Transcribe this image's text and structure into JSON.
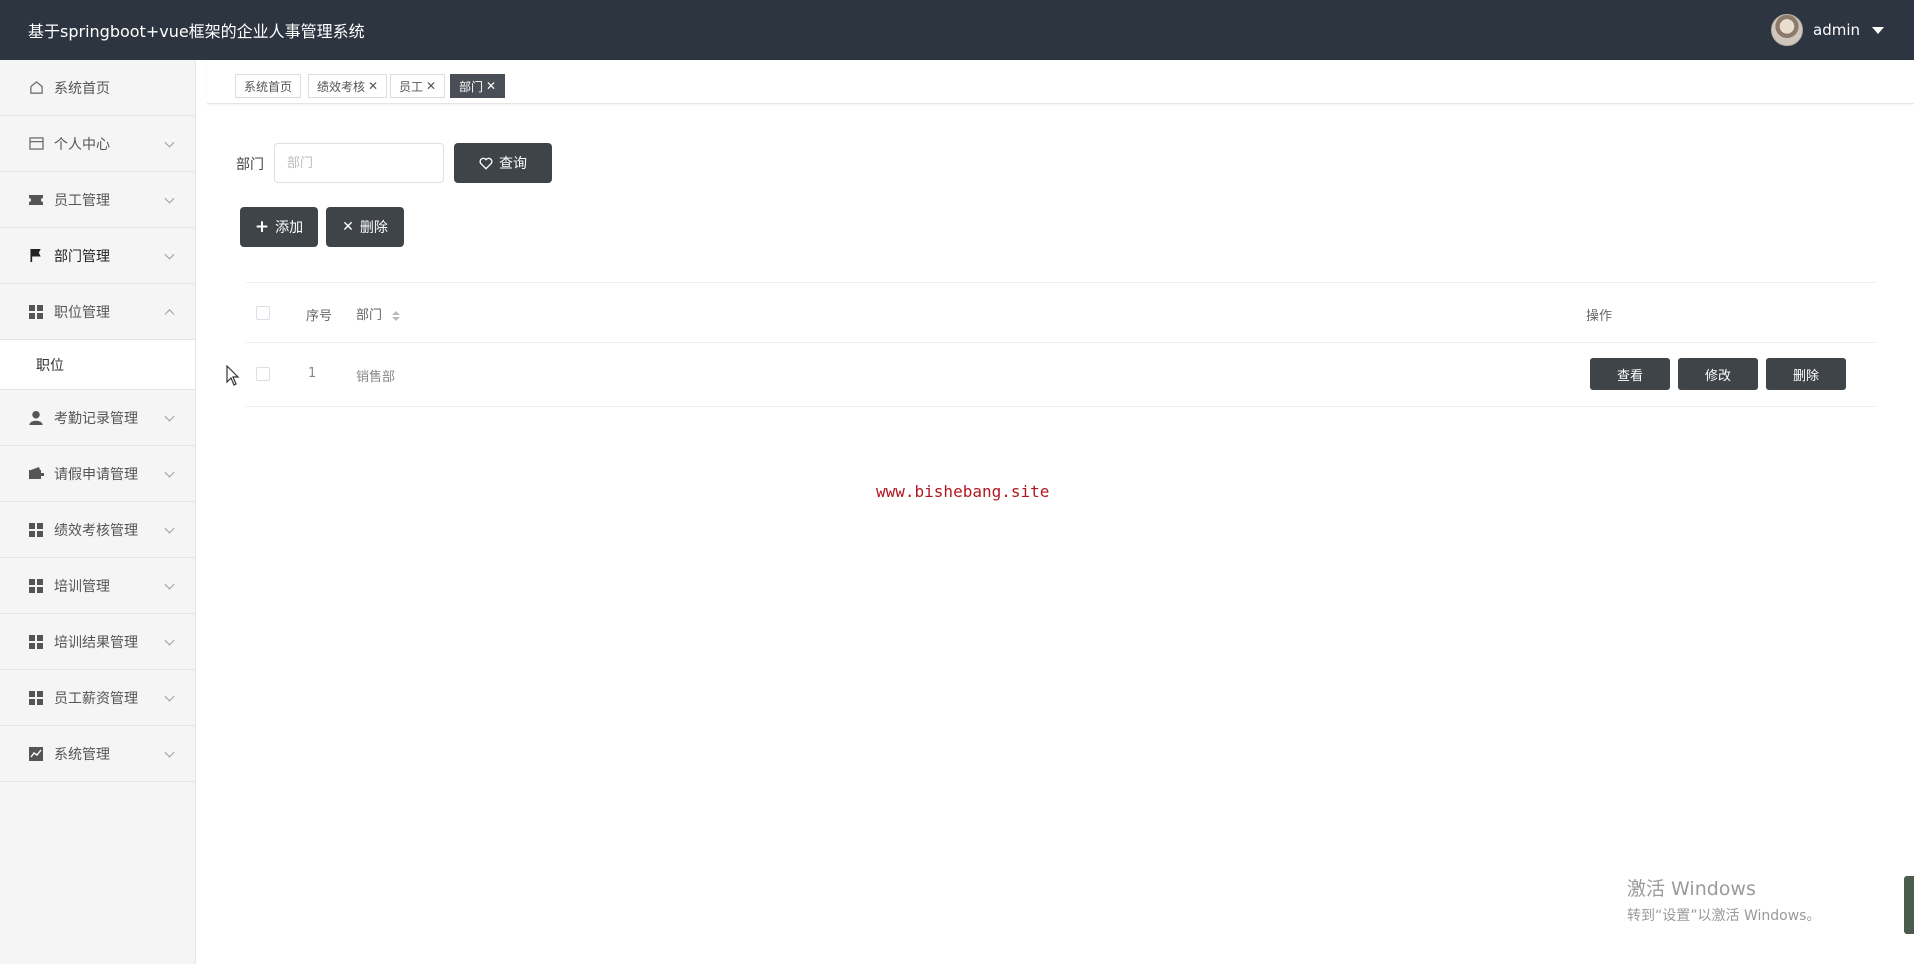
{
  "header": {
    "title": "基于springboot+vue框架的企业人事管理系统",
    "username": "admin"
  },
  "sidebar": {
    "items": [
      {
        "label": "系统首页",
        "icon": "home-icon"
      },
      {
        "label": "个人中心",
        "icon": "card-icon"
      },
      {
        "label": "员工管理",
        "icon": "ticket-icon"
      },
      {
        "label": "部门管理",
        "icon": "flag-icon"
      },
      {
        "label": "职位管理",
        "icon": "grid-icon"
      },
      {
        "label": "考勤记录管理",
        "icon": "user-icon"
      },
      {
        "label": "请假申请管理",
        "icon": "wallet-icon"
      },
      {
        "label": "绩效考核管理",
        "icon": "grid-icon"
      },
      {
        "label": "培训管理",
        "icon": "grid-icon"
      },
      {
        "label": "培训结果管理",
        "icon": "grid-icon"
      },
      {
        "label": "员工薪资管理",
        "icon": "grid-icon"
      },
      {
        "label": "系统管理",
        "icon": "chart-icon"
      }
    ],
    "submenu": {
      "label": "职位"
    }
  },
  "tabs": [
    {
      "label": "系统首页",
      "closable": false,
      "active": false
    },
    {
      "label": "绩效考核",
      "closable": true,
      "active": false
    },
    {
      "label": "员工",
      "closable": true,
      "active": false
    },
    {
      "label": "部门",
      "closable": true,
      "active": true
    }
  ],
  "search": {
    "label": "部门",
    "placeholder": "部门",
    "value": "",
    "button": "查询"
  },
  "actions": {
    "add": "添加",
    "delete": "删除"
  },
  "table": {
    "columns": {
      "index": "序号",
      "department": "部门",
      "ops": "操作"
    },
    "rows": [
      {
        "index": "1",
        "department": "销售部",
        "view": "查看",
        "edit": "修改",
        "delete": "删除"
      }
    ]
  },
  "watermark": "www.bishebang.site",
  "os_notice": {
    "line1": "激活 Windows",
    "line2": "转到“设置”以激活 Windows。"
  },
  "colors": {
    "header_bg": "#2d3540",
    "button_dark": "#3f4449",
    "watermark": "#b0171f"
  }
}
